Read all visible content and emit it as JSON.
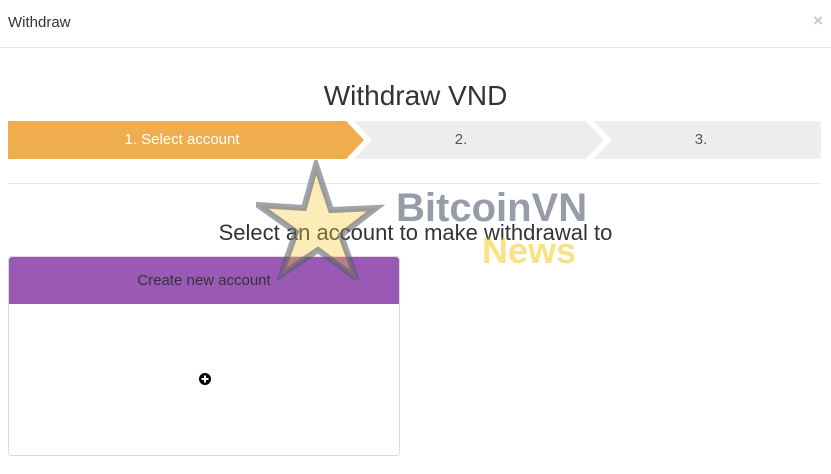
{
  "header": {
    "title": "Withdraw",
    "close_label": "×"
  },
  "page": {
    "title": "Withdraw VND",
    "subtitle": "Select an account to make withdrawal to"
  },
  "steps": [
    {
      "label": "1. Select account",
      "active": true
    },
    {
      "label": "2.",
      "active": false
    },
    {
      "label": "3.",
      "active": false
    }
  ],
  "account_card": {
    "header_label": "Create new account",
    "icon": "plus-circle-icon"
  },
  "watermark": {
    "brand": "BitcoinVN",
    "sub": "News"
  },
  "colors": {
    "step_active": "#f0ad4e",
    "step_inactive": "#eeeeee",
    "card_header": "#9b59b6"
  }
}
